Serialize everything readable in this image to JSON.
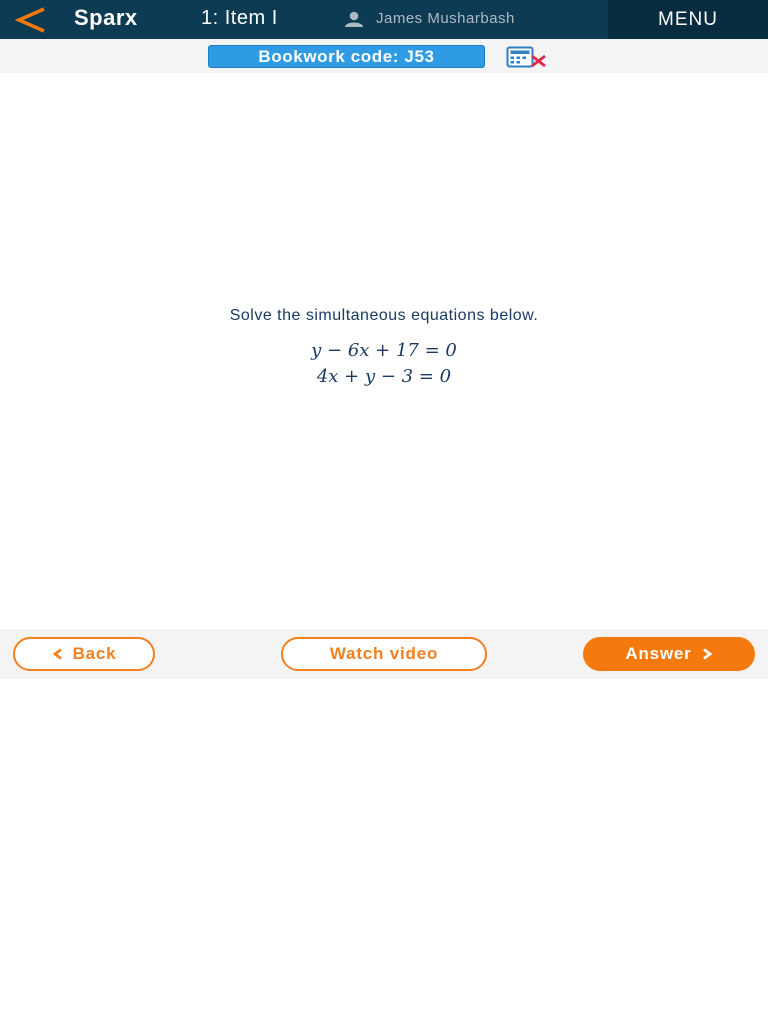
{
  "header": {
    "brand": "Sparx",
    "item_title": "1: Item I",
    "user_name": "James Musharbash",
    "menu_label": "MENU"
  },
  "bookwork": {
    "code_label": "Bookwork code: J53"
  },
  "question": {
    "prompt": "Solve the simultaneous equations below.",
    "equations": [
      "y − 6x + 17 = 0",
      "4x + y − 3 = 0"
    ]
  },
  "footer": {
    "back_label": "Back",
    "watch_label": "Watch video",
    "answer_label": "Answer"
  },
  "colors": {
    "header_bg": "#0d3b54",
    "menu_bg": "#072b3f",
    "accent_orange": "#f47a10",
    "bookwork_blue": "#2f9be5",
    "text_navy": "#1a3a64"
  },
  "icons": {
    "back": "chevron-left-icon",
    "user": "user-icon",
    "calculator": "calculator-not-allowed-icon",
    "back_button": "chevron-left-icon",
    "answer_button": "chevron-right-icon"
  }
}
